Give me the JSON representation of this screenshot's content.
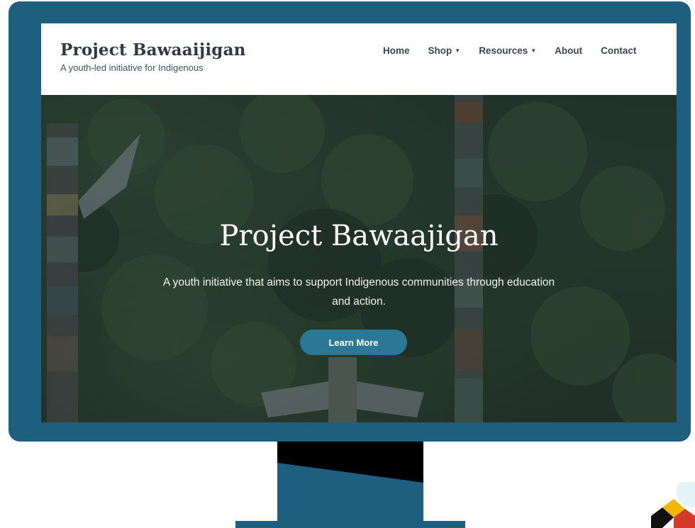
{
  "site": {
    "title": "Project Bawaaijigan",
    "tagline": "A youth-led initiative for Indigenous"
  },
  "nav": {
    "items": [
      {
        "label": "Home",
        "dropdown": false
      },
      {
        "label": "Shop",
        "dropdown": true
      },
      {
        "label": "Resources",
        "dropdown": true
      },
      {
        "label": "About",
        "dropdown": false
      },
      {
        "label": "Contact",
        "dropdown": false
      }
    ],
    "caret_glyph": "▼"
  },
  "hero": {
    "title": "Project Bawaajigan",
    "subtitle": "A youth initiative that aims to support Indigenous communities through education and action.",
    "button_label": "Learn More"
  },
  "colors": {
    "monitor_frame": "#1e5f80",
    "button": "#2a7895",
    "heading_text": "#2f3a44",
    "logo_black": "#111111",
    "logo_red": "#d33a2c",
    "logo_yellow": "#f2b705",
    "logo_white": "#ffffff"
  }
}
